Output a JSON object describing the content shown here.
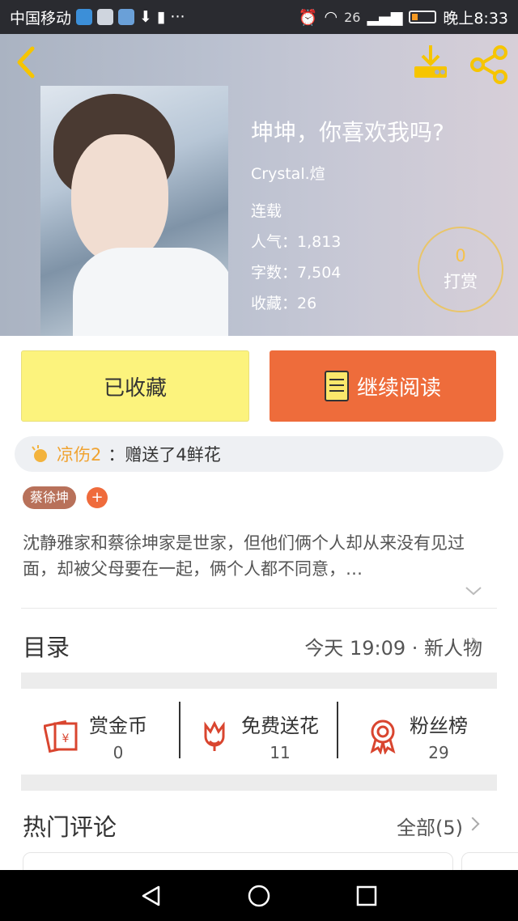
{
  "status_bar": {
    "carrier": "中国移动",
    "network": "26",
    "time": "晚上8:33"
  },
  "header": {
    "title": "坤坤，你喜欢我吗?",
    "author": "Crystal.煊",
    "status": "连载",
    "popularity": "人气：1,813",
    "word_count": "字数：7,504",
    "favorites": "收藏：26",
    "reward_count": "0",
    "reward_label": "打赏"
  },
  "actions": {
    "favorited_label": "已收藏",
    "continue_label": "继续阅读"
  },
  "gift": {
    "user": "凉伤2",
    "text": "：赠送了4鲜花"
  },
  "tags": {
    "tag1": "蔡徐坤",
    "add": "+"
  },
  "summary": "沈静雅家和蔡徐坤家是世家，但他们俩个人却从来没有见过面，却被父母要在一起，俩个人都不同意，…",
  "toc": {
    "title": "目录",
    "latest": "今天 19:09 · 新人物"
  },
  "stats": [
    {
      "label": "赏金币",
      "value": "0"
    },
    {
      "label": "免费送花",
      "value": "11"
    },
    {
      "label": "粉丝榜",
      "value": "29"
    }
  ],
  "comments": {
    "title": "热门评论",
    "all_label": "全部(5)"
  },
  "colors": {
    "accent": "#ee6c3b",
    "yellow": "#fcf37d",
    "gold": "#f6c500"
  }
}
